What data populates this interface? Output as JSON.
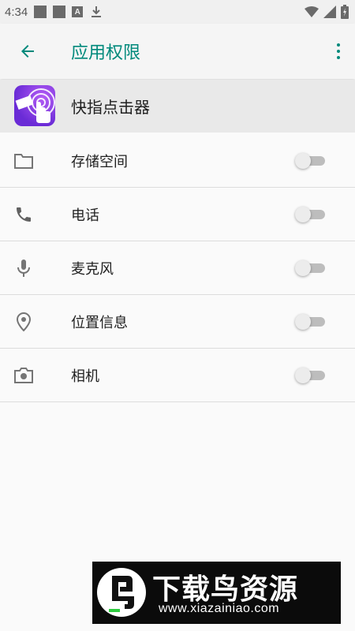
{
  "status_bar": {
    "time": "4:34",
    "icons": [
      "notification-square-icon",
      "notification-square-icon",
      "a-icon",
      "download-icon",
      "wifi-icon",
      "signal-icon",
      "battery-icon"
    ],
    "a_label": "A"
  },
  "app_bar": {
    "title": "应用权限",
    "accent_color": "#00897b"
  },
  "app": {
    "name": "快指点击器"
  },
  "permissions": [
    {
      "label": "存储空间",
      "icon": "folder-icon",
      "enabled": false
    },
    {
      "label": "电话",
      "icon": "phone-icon",
      "enabled": false
    },
    {
      "label": "麦克风",
      "icon": "microphone-icon",
      "enabled": false
    },
    {
      "label": "位置信息",
      "icon": "location-icon",
      "enabled": false
    },
    {
      "label": "相机",
      "icon": "camera-icon",
      "enabled": false
    }
  ],
  "watermark": {
    "title": "下载鸟资源",
    "url": "www.xiazainiao.com"
  }
}
